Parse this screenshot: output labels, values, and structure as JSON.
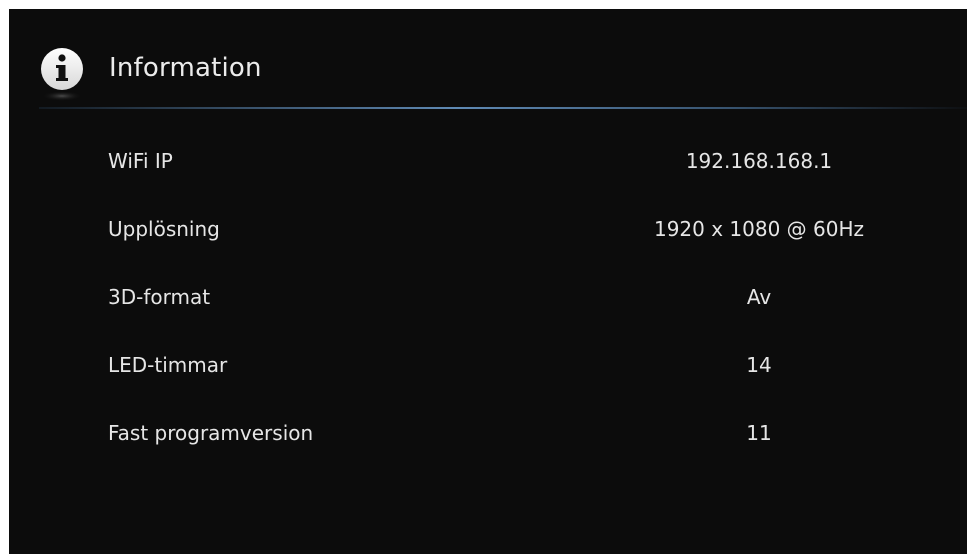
{
  "header": {
    "title": "Information",
    "icon": "info-icon"
  },
  "info_rows": [
    {
      "label": "WiFi IP",
      "value": "192.168.168.1"
    },
    {
      "label": "Upplösning",
      "value": "1920 x 1080 @ 60Hz"
    },
    {
      "label": "3D-format",
      "value": "Av"
    },
    {
      "label": "LED-timmar",
      "value": "14"
    },
    {
      "label": "Fast programversion",
      "value": "11"
    }
  ],
  "colors": {
    "background": "#0c0c0c",
    "text": "#e6e6e6",
    "divider_accent": "#6ea0d2"
  }
}
